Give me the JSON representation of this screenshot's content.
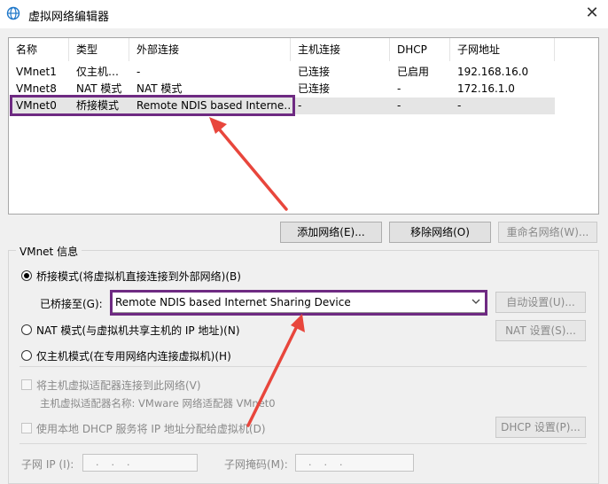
{
  "window": {
    "title": "虚拟网络编辑器",
    "close_label": "✕"
  },
  "table": {
    "columns": [
      "名称",
      "类型",
      "外部连接",
      "主机连接",
      "DHCP",
      "子网地址"
    ],
    "rows": [
      [
        "VMnet1",
        "仅主机…",
        "-",
        "已连接",
        "已启用",
        "192.168.16.0"
      ],
      [
        "VMnet8",
        "NAT 模式",
        "NAT 模式",
        "已连接",
        "-",
        "172.16.1.0"
      ],
      [
        "VMnet0",
        "桥接模式",
        "Remote NDIS based Interne…",
        "-",
        "-",
        "-"
      ]
    ],
    "selected_row": 2
  },
  "buttons": {
    "add": "添加网络(E)...",
    "remove": "移除网络(O)",
    "rename": "重命名网络(W)..."
  },
  "vmnet_info": {
    "legend": "VMnet 信息",
    "bridged_label": "桥接模式(将虚拟机直接连接到外部网络)(B)",
    "bridged_to_label": "已桥接至(G):",
    "bridged_to_value": "Remote NDIS based Internet Sharing Device",
    "auto_settings": "自动设置(U)...",
    "nat_label": "NAT 模式(与虚拟机共享主机的 IP 地址)(N)",
    "nat_settings": "NAT 设置(S)...",
    "hostonly_label": "仅主机模式(在专用网络内连接虚拟机)(H)",
    "connect_adapter_label": "将主机虚拟适配器连接到此网络(V)",
    "adapter_name_label": "主机虚拟适配器名称: VMware 网络适配器 VMnet0",
    "dhcp_label": "使用本地 DHCP 服务将 IP 地址分配给虚拟机(D)",
    "dhcp_settings": "DHCP 设置(P)...",
    "subnet_ip_label": "子网 IP (I):",
    "subnet_mask_label": "子网掩码(M):",
    "ip_dots": "...",
    "mode": "bridged"
  },
  "colors": {
    "highlight": "#6e2a82",
    "arrow": "#e8463c"
  }
}
